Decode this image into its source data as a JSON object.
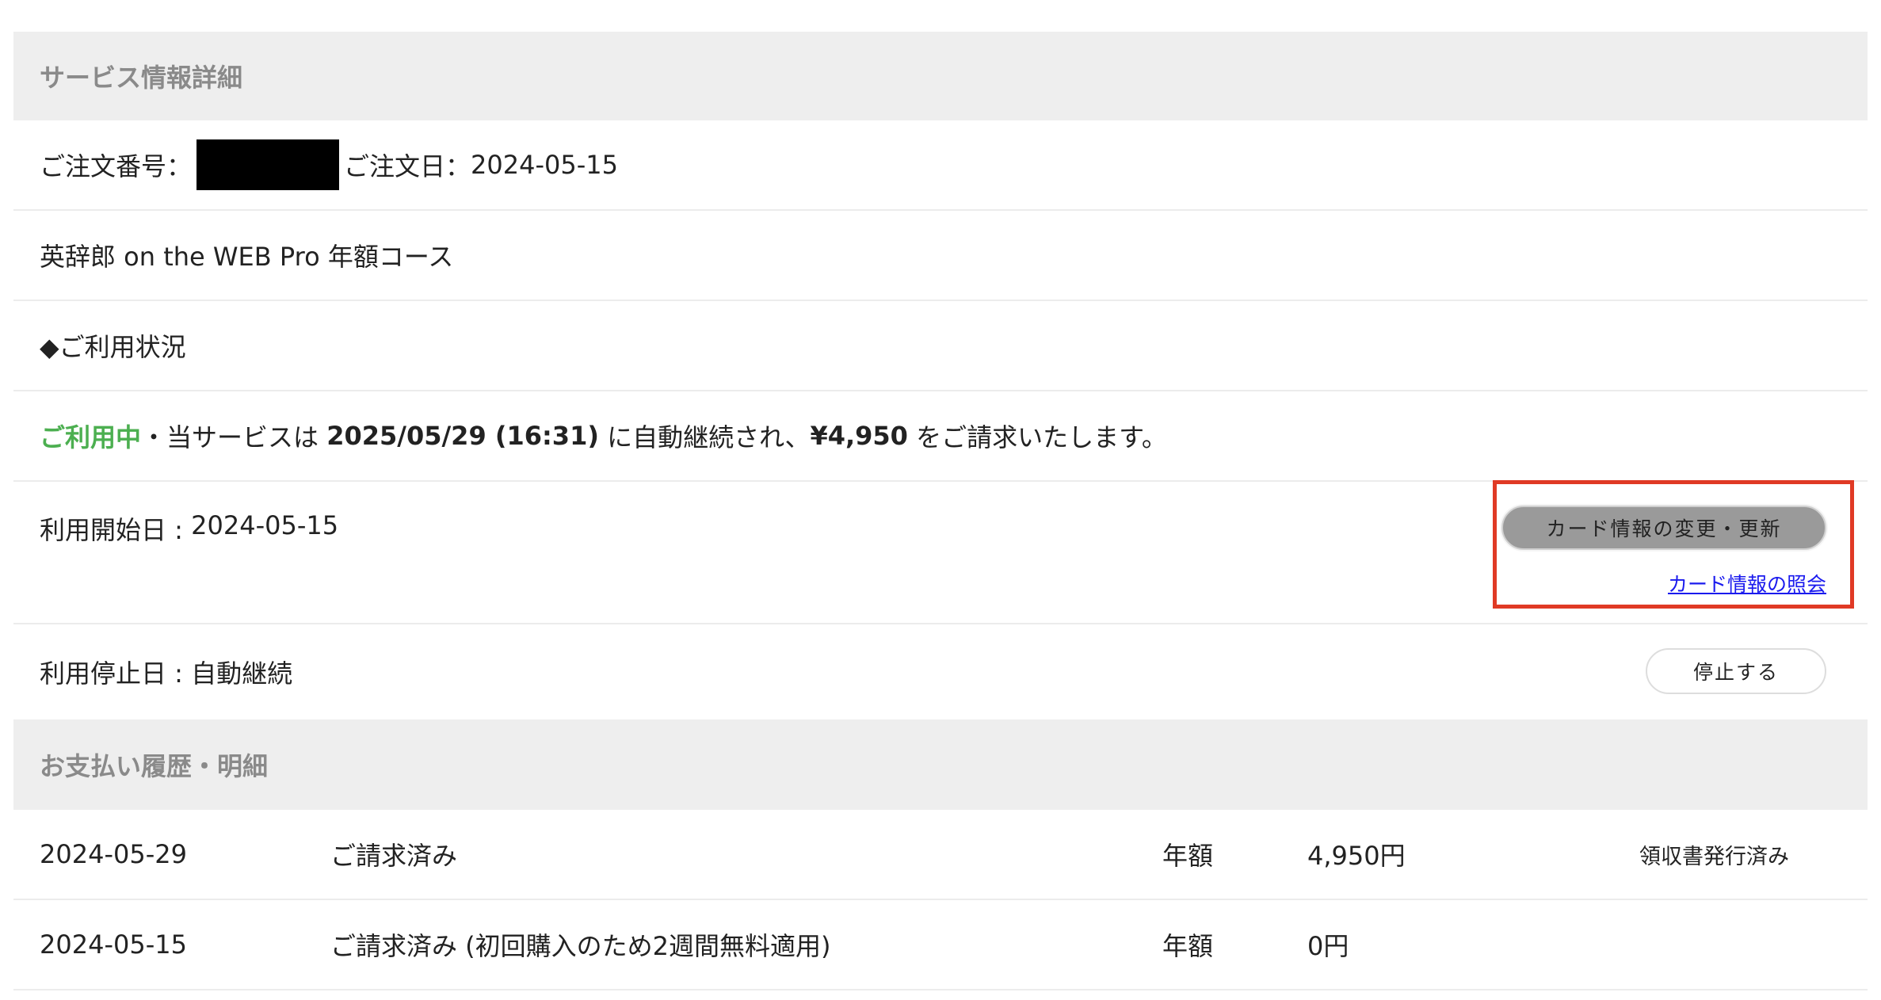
{
  "service_section": {
    "title": "サービス情報詳細",
    "order_number_label": "ご注文番号：",
    "order_date_label": "ご注文日：",
    "order_date": "2024-05-15",
    "product_name": "英辞郎 on the WEB Pro 年額コース",
    "usage_heading": "◆ご利用状況",
    "status_active": "ご利用中",
    "status_text_1": "・当サービスは ",
    "renewal_datetime": "2025/05/29 (16:31)",
    "status_text_2": " に自動継続され、",
    "renewal_amount": "¥4,950",
    "status_text_3": " をご請求いたします。",
    "start_date_label": "利用開始日 : ",
    "start_date": "2024-05-15",
    "card_update_button": "カード情報の変更・更新",
    "card_view_link": "カード情報の照会",
    "stop_date_label": "利用停止日 : ",
    "stop_date_value": "自動継続",
    "stop_button": "停止する"
  },
  "payment_section": {
    "title": "お支払い履歴・明細",
    "rows": [
      {
        "date": "2024-05-29",
        "status": "ご請求済み",
        "plan": "年額",
        "amount": "4,950円",
        "receipt": "領収書発行済み"
      },
      {
        "date": "2024-05-15",
        "status": "ご請求済み (初回購入のため2週間無料適用)",
        "plan": "年額",
        "amount": "0円",
        "receipt": ""
      }
    ]
  },
  "colors": {
    "header_bg": "#eeeeee",
    "active_green": "#4caf50",
    "highlight_red": "#e03a25",
    "link_blue": "#1a1aee"
  }
}
